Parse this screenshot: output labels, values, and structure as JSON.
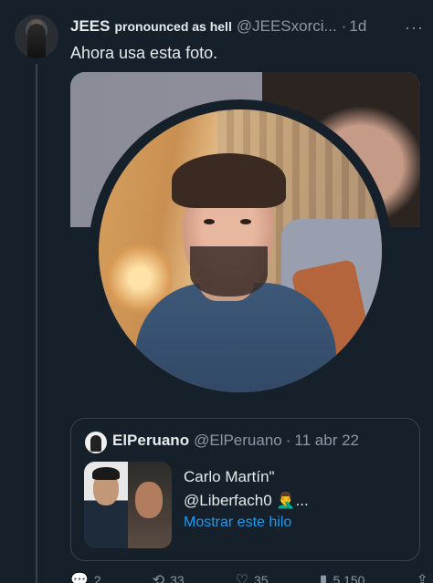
{
  "tweet": {
    "author_name": "JEES",
    "author_tag": "pronounced as hell",
    "handle": "@JEESxorci...",
    "separator": "·",
    "time": "1d",
    "text": "Ahora usa esta foto.",
    "more_icon": "ellipsis-icon"
  },
  "quote": {
    "name": "ElPeruano",
    "handle": "@ElPeruano",
    "separator": "·",
    "date": "11 abr 22",
    "text_line1": "Carlo Martín\"",
    "text_line2": "@Liberfach0 🤦‍♂️...",
    "link": "Mostrar este hilo"
  },
  "actions": [
    {
      "icon": "reply-icon",
      "glyph": "💬",
      "count": "2"
    },
    {
      "icon": "retweet-icon",
      "glyph": "⟲",
      "count": "33"
    },
    {
      "icon": "like-icon",
      "glyph": "♡",
      "count": "35"
    },
    {
      "icon": "views-icon",
      "glyph": "▮",
      "count": "5.150"
    },
    {
      "icon": "share-icon",
      "glyph": "⇪",
      "count": ""
    }
  ],
  "colors": {
    "background": "#15202b",
    "text": "#e7e9ea",
    "muted": "#8b98a5",
    "link": "#1d9bf0",
    "border": "#38444d"
  }
}
